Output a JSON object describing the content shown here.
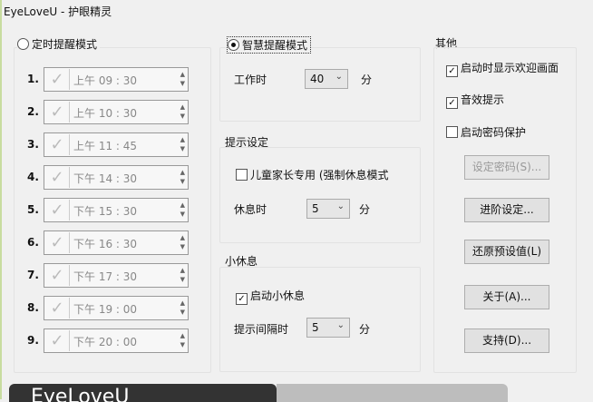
{
  "title": "EyeLoveU - 护眼精灵",
  "timer_mode": {
    "label": "定时提醒模式",
    "selected": false,
    "rows": [
      {
        "n": "1.",
        "time": "上午 09 : 30"
      },
      {
        "n": "2.",
        "time": "上午 10 : 30"
      },
      {
        "n": "3.",
        "time": "上午 11 : 45"
      },
      {
        "n": "4.",
        "time": "下午 14 : 30"
      },
      {
        "n": "5.",
        "time": "下午 15 : 30"
      },
      {
        "n": "6.",
        "time": "下午 16 : 30"
      },
      {
        "n": "7.",
        "time": "下午 17 : 30"
      },
      {
        "n": "8.",
        "time": "下午 19 : 00"
      },
      {
        "n": "9.",
        "time": "下午 20 : 00"
      }
    ]
  },
  "smart_mode": {
    "label": "智慧提醒模式",
    "selected": true,
    "work_label": "工作时",
    "work_value": "40",
    "unit": "分"
  },
  "prompt": {
    "title": "提示设定",
    "child_label": "儿童家长专用 (强制休息模式",
    "rest_label": "休息时",
    "rest_value": "5",
    "unit": "分"
  },
  "short_break": {
    "title": "小休息",
    "enable_label": "启动小休息",
    "interval_label": "提示间隔时",
    "interval_value": "5",
    "unit": "分"
  },
  "other": {
    "title": "其他",
    "show_welcome": "启动时显示欢迎画面",
    "sound": "音效提示",
    "password_protect": "启动密码保护",
    "buttons": {
      "set_password": "设定密码(S)...",
      "advanced": "进阶设定...",
      "restore": "还原预设值(L)",
      "about": "关于(A)...",
      "support": "支持(D)..."
    }
  },
  "banner": {
    "text": "EyeLoveU"
  }
}
